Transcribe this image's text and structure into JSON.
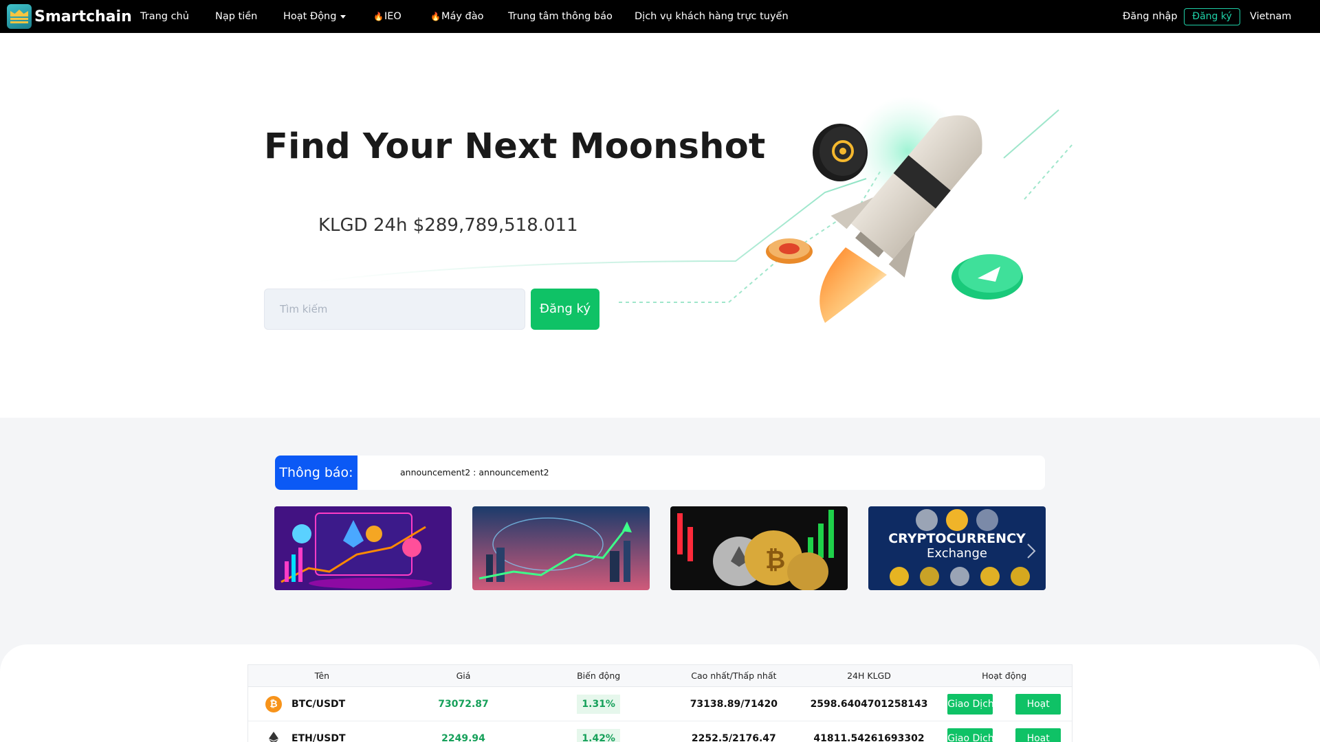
{
  "nav": {
    "brand": "Smartchain",
    "links": [
      {
        "label": "Trang chủ"
      },
      {
        "label": "Nạp tiền"
      },
      {
        "label": "Hoạt Động"
      },
      {
        "label": "IEO"
      },
      {
        "label": "Máy đào"
      },
      {
        "label": "Trung tâm thông báo"
      },
      {
        "label": "Dịch vụ khách hàng trực tuyến"
      }
    ],
    "login": "Đăng nhập",
    "register": "Đăng ký",
    "language": "Vietnam"
  },
  "hero": {
    "title": "Find Your Next Moonshot",
    "volume": "KLGD 24h $289,789,518.011",
    "search_placeholder": "Tìm kiếm",
    "register_button": "Đăng ký"
  },
  "announcement": {
    "label": "Thông báo:",
    "text": "announcement2 : announcement2"
  },
  "banners": {
    "banner4_title": "CRYPTOCURRENCY",
    "banner4_subtitle": "Exchange"
  },
  "market": {
    "columns": [
      "Tên",
      "Giá",
      "Biến động",
      "Cao nhất/Thấp nhất",
      "24H KLGD",
      "Hoạt động"
    ],
    "rows": [
      {
        "pair": "BTC/USDT",
        "price": "73072.87",
        "change": "1.31%",
        "high_low": "73138.89/71420",
        "volume": "2598.6404701258143",
        "trade": "Giao Dịch",
        "action": "Hoạt"
      },
      {
        "pair": "ETH/USDT",
        "price": "2249.94",
        "change": "1.42%",
        "high_low": "2252.5/2176.47",
        "volume": "41811.54261693302",
        "trade": "Giao Dịch",
        "action": "Hoạt"
      }
    ]
  },
  "colors": {
    "nav_bg": "#000000",
    "accent_green": "#0fc266",
    "announce_blue": "#0b59f5",
    "price_green": "#16a05a",
    "btc_orange": "#f7931a"
  },
  "icons": {
    "dropdown": "caret-down-icon",
    "hot": "fire-icon",
    "btc": "bitcoin-icon",
    "eth": "ethereum-icon"
  }
}
